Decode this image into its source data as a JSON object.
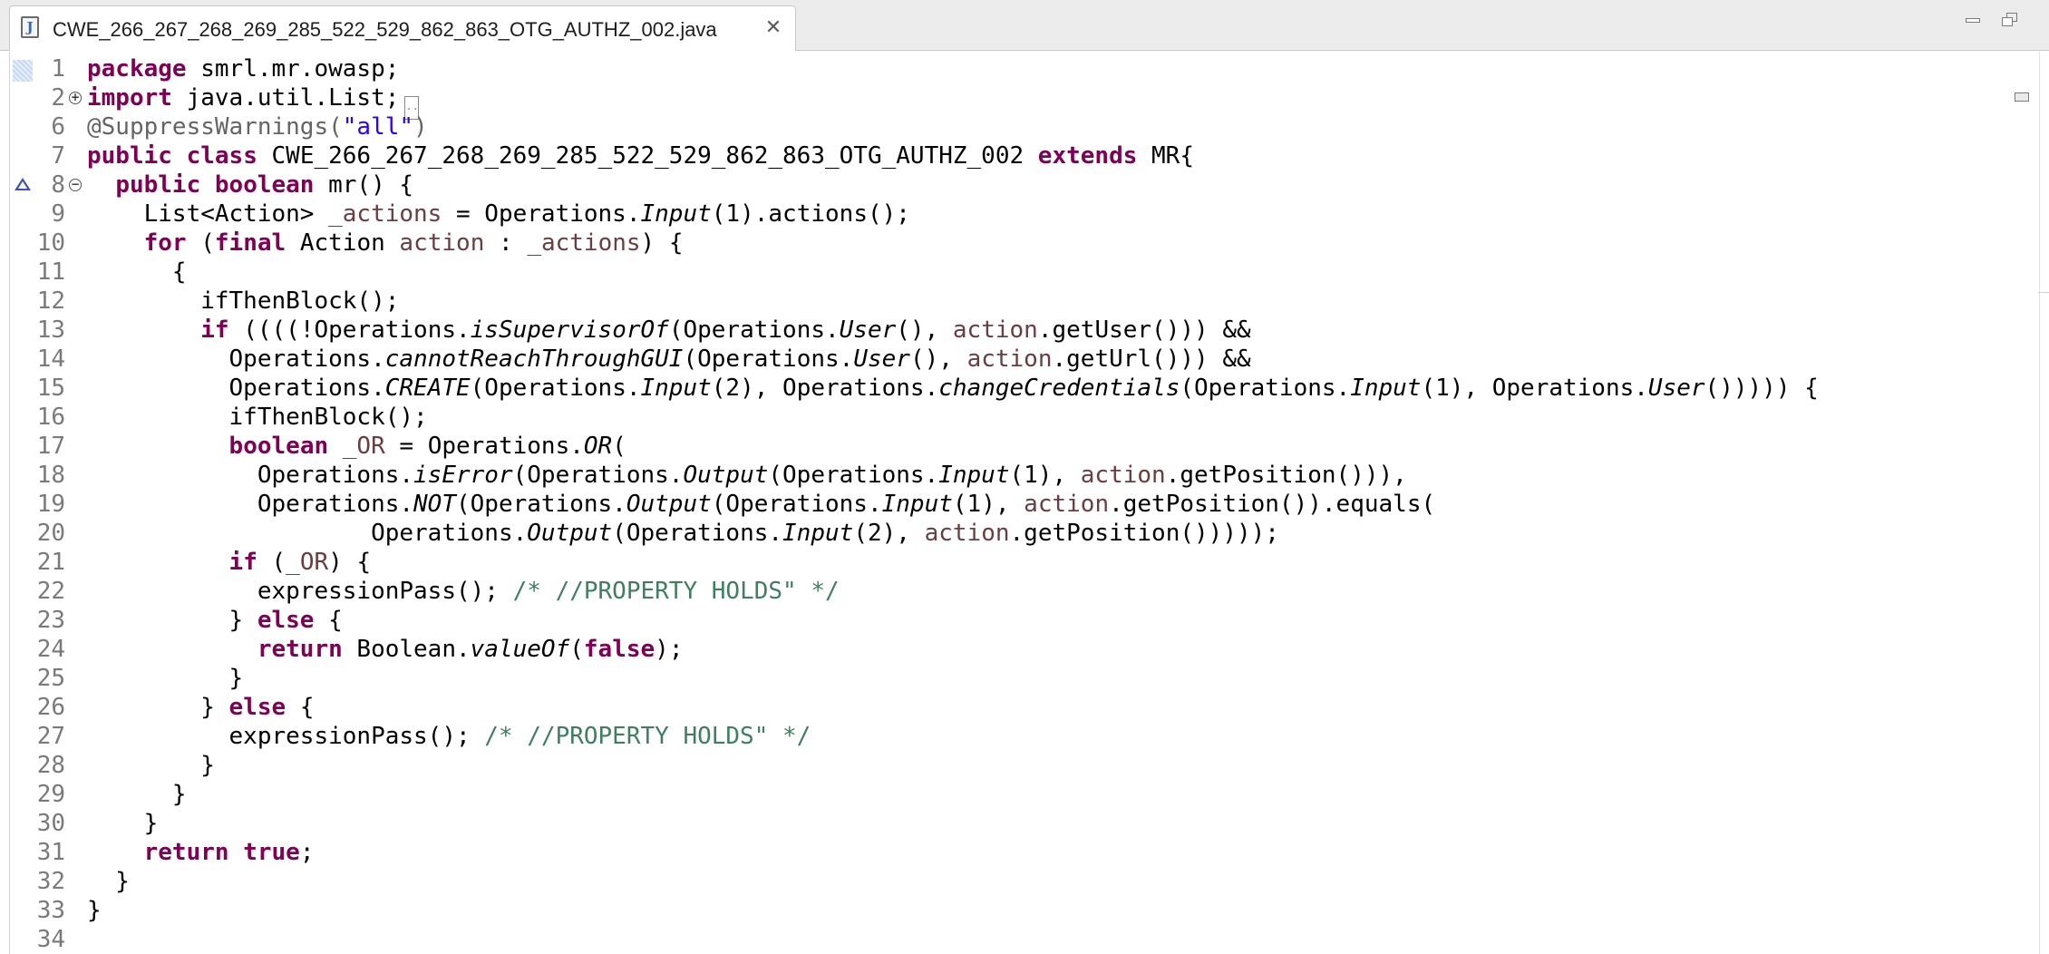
{
  "tab": {
    "title": "CWE_266_267_268_269_285_522_529_862_863_OTG_AUTHZ_002.java",
    "close_glyph": "✕",
    "icon_letter": "J",
    "icon": "java-file-icon"
  },
  "window_controls": {
    "minimize": "minimize-icon",
    "maximize": "restore-icon"
  },
  "editor": {
    "collapsed_glyph": "..",
    "colors": {
      "keyword": "#7f0055",
      "string": "#2a00ff",
      "comment": "#3f7f5f",
      "field": "#6a3e3e",
      "annotation": "#646464"
    },
    "lines": [
      {
        "n": "1",
        "segs": [
          {
            "t": "package",
            "c": "kw"
          },
          {
            "t": " smrl.mr.owasp;"
          }
        ]
      },
      {
        "n": "2",
        "segs": [
          {
            "t": "import",
            "c": "kw"
          },
          {
            "t": " java.util.List;"
          }
        ]
      },
      {
        "n": "6",
        "segs": [
          {
            "t": "@SuppressWarnings(",
            "c": "ann"
          },
          {
            "t": "\"all\"",
            "c": "str"
          },
          {
            "t": ")",
            "c": "ann"
          }
        ]
      },
      {
        "n": "7",
        "segs": [
          {
            "t": "public",
            "c": "kw"
          },
          {
            "t": " "
          },
          {
            "t": "class",
            "c": "kw"
          },
          {
            "t": " CWE_266_267_268_269_285_522_529_862_863_OTG_AUTHZ_002 "
          },
          {
            "t": "extends",
            "c": "kw"
          },
          {
            "t": " MR{"
          }
        ]
      },
      {
        "n": "8",
        "segs": [
          {
            "t": "  "
          },
          {
            "t": "public",
            "c": "kw"
          },
          {
            "t": " "
          },
          {
            "t": "boolean",
            "c": "kw"
          },
          {
            "t": " mr() {"
          }
        ]
      },
      {
        "n": "9",
        "segs": [
          {
            "t": "    List<Action> "
          },
          {
            "t": "_actions",
            "c": "field"
          },
          {
            "t": " = Operations."
          },
          {
            "t": "Input",
            "c": "ital"
          },
          {
            "t": "(1).actions();"
          }
        ]
      },
      {
        "n": "10",
        "segs": [
          {
            "t": "    "
          },
          {
            "t": "for",
            "c": "kw"
          },
          {
            "t": " ("
          },
          {
            "t": "final",
            "c": "kw"
          },
          {
            "t": " Action "
          },
          {
            "t": "action",
            "c": "field"
          },
          {
            "t": " : "
          },
          {
            "t": "_actions",
            "c": "field"
          },
          {
            "t": ") {"
          }
        ]
      },
      {
        "n": "11",
        "segs": [
          {
            "t": "      {"
          }
        ]
      },
      {
        "n": "12",
        "segs": [
          {
            "t": "        ifThenBlock();"
          }
        ]
      },
      {
        "n": "13",
        "segs": [
          {
            "t": "        "
          },
          {
            "t": "if",
            "c": "kw"
          },
          {
            "t": " ((((!Operations."
          },
          {
            "t": "isSupervisorOf",
            "c": "ital"
          },
          {
            "t": "(Operations."
          },
          {
            "t": "User",
            "c": "ital"
          },
          {
            "t": "(), "
          },
          {
            "t": "action",
            "c": "field"
          },
          {
            "t": ".getUser())) &&"
          }
        ]
      },
      {
        "n": "14",
        "segs": [
          {
            "t": "          Operations."
          },
          {
            "t": "cannotReachThroughGUI",
            "c": "ital"
          },
          {
            "t": "(Operations."
          },
          {
            "t": "User",
            "c": "ital"
          },
          {
            "t": "(), "
          },
          {
            "t": "action",
            "c": "field"
          },
          {
            "t": ".getUrl())) &&"
          }
        ]
      },
      {
        "n": "15",
        "segs": [
          {
            "t": "          Operations."
          },
          {
            "t": "CREATE",
            "c": "ital"
          },
          {
            "t": "(Operations."
          },
          {
            "t": "Input",
            "c": "ital"
          },
          {
            "t": "(2), Operations."
          },
          {
            "t": "changeCredentials",
            "c": "ital"
          },
          {
            "t": "(Operations."
          },
          {
            "t": "Input",
            "c": "ital"
          },
          {
            "t": "(1), Operations."
          },
          {
            "t": "User",
            "c": "ital"
          },
          {
            "t": "()))))"
          },
          {
            "t": " {"
          }
        ]
      },
      {
        "n": "16",
        "segs": [
          {
            "t": "          ifThenBlock();"
          }
        ]
      },
      {
        "n": "17",
        "segs": [
          {
            "t": "          "
          },
          {
            "t": "boolean",
            "c": "kw"
          },
          {
            "t": " "
          },
          {
            "t": "_OR",
            "c": "field"
          },
          {
            "t": " = Operations."
          },
          {
            "t": "OR",
            "c": "ital"
          },
          {
            "t": "("
          }
        ]
      },
      {
        "n": "18",
        "segs": [
          {
            "t": "            Operations."
          },
          {
            "t": "isError",
            "c": "ital"
          },
          {
            "t": "(Operations."
          },
          {
            "t": "Output",
            "c": "ital"
          },
          {
            "t": "(Operations."
          },
          {
            "t": "Input",
            "c": "ital"
          },
          {
            "t": "(1), "
          },
          {
            "t": "action",
            "c": "field"
          },
          {
            "t": ".getPosition())),"
          }
        ]
      },
      {
        "n": "19",
        "segs": [
          {
            "t": "            Operations."
          },
          {
            "t": "NOT",
            "c": "ital"
          },
          {
            "t": "(Operations."
          },
          {
            "t": "Output",
            "c": "ital"
          },
          {
            "t": "(Operations."
          },
          {
            "t": "Input",
            "c": "ital"
          },
          {
            "t": "(1), "
          },
          {
            "t": "action",
            "c": "field"
          },
          {
            "t": ".getPosition()).equals("
          }
        ]
      },
      {
        "n": "20",
        "segs": [
          {
            "t": "                    Operations."
          },
          {
            "t": "Output",
            "c": "ital"
          },
          {
            "t": "(Operations."
          },
          {
            "t": "Input",
            "c": "ital"
          },
          {
            "t": "(2), "
          },
          {
            "t": "action",
            "c": "field"
          },
          {
            "t": ".getPosition()))));"
          }
        ]
      },
      {
        "n": "21",
        "segs": [
          {
            "t": "          "
          },
          {
            "t": "if",
            "c": "kw"
          },
          {
            "t": " ("
          },
          {
            "t": "_OR",
            "c": "field"
          },
          {
            "t": ") {"
          }
        ]
      },
      {
        "n": "22",
        "segs": [
          {
            "t": "            expressionPass(); "
          },
          {
            "t": "/* //PROPERTY HOLDS\" */",
            "c": "com"
          }
        ]
      },
      {
        "n": "23",
        "segs": [
          {
            "t": "          } "
          },
          {
            "t": "else",
            "c": "kw"
          },
          {
            "t": " {"
          }
        ]
      },
      {
        "n": "24",
        "segs": [
          {
            "t": "            "
          },
          {
            "t": "return",
            "c": "kw"
          },
          {
            "t": " Boolean."
          },
          {
            "t": "valueOf",
            "c": "ital"
          },
          {
            "t": "("
          },
          {
            "t": "false",
            "c": "kw"
          },
          {
            "t": ");"
          }
        ]
      },
      {
        "n": "25",
        "segs": [
          {
            "t": "          }"
          }
        ]
      },
      {
        "n": "26",
        "segs": [
          {
            "t": "        } "
          },
          {
            "t": "else",
            "c": "kw"
          },
          {
            "t": " {"
          }
        ]
      },
      {
        "n": "27",
        "segs": [
          {
            "t": "          expressionPass(); "
          },
          {
            "t": "/* //PROPERTY HOLDS\" */",
            "c": "com"
          }
        ]
      },
      {
        "n": "28",
        "segs": [
          {
            "t": "        }"
          }
        ]
      },
      {
        "n": "29",
        "segs": [
          {
            "t": "      }"
          }
        ]
      },
      {
        "n": "30",
        "segs": [
          {
            "t": "    }"
          }
        ]
      },
      {
        "n": "31",
        "segs": [
          {
            "t": "    "
          },
          {
            "t": "return",
            "c": "kw"
          },
          {
            "t": " "
          },
          {
            "t": "true",
            "c": "kw"
          },
          {
            "t": ";"
          }
        ]
      },
      {
        "n": "32",
        "segs": [
          {
            "t": "  }"
          }
        ]
      },
      {
        "n": "33",
        "segs": [
          {
            "t": "}"
          }
        ]
      },
      {
        "n": "34",
        "segs": []
      }
    ]
  }
}
